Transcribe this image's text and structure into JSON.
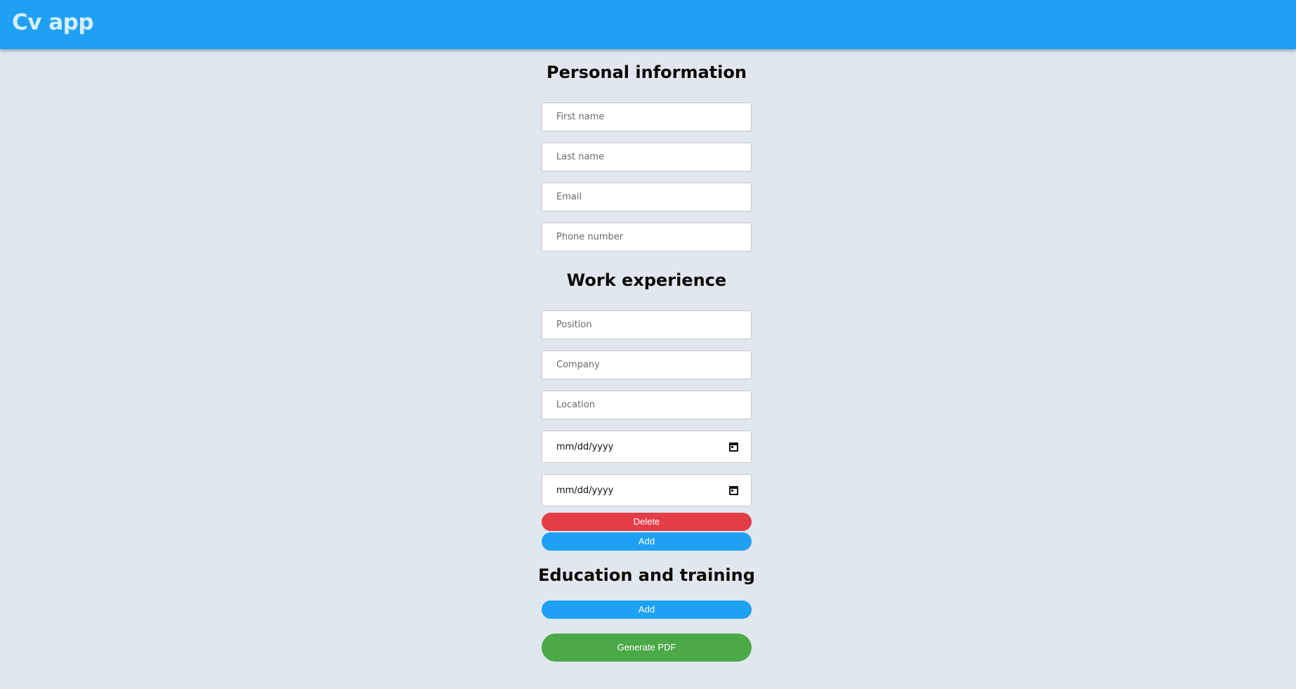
{
  "header": {
    "title": "Cv app"
  },
  "personal": {
    "title": "Personal information",
    "first_name_placeholder": "First name",
    "last_name_placeholder": "Last name",
    "email_placeholder": "Email",
    "phone_placeholder": "Phone number"
  },
  "work": {
    "title": "Work experience",
    "position_placeholder": "Position",
    "company_placeholder": "Company",
    "location_placeholder": "Location",
    "start_date": "mm/dd/yyyy",
    "end_date": "mm/dd/yyyy",
    "delete_label": "Delete",
    "add_label": "Add"
  },
  "education": {
    "title": "Education and training",
    "add_label": "Add"
  },
  "actions": {
    "generate_pdf_label": "Generate PDF"
  },
  "colors": {
    "header": "#1fa1f3",
    "background": "#e0e7ef",
    "delete": "#e33d47",
    "add": "#1fa1f3",
    "generate": "#4ca948"
  },
  "icons": {
    "date_picker": "calendar-icon"
  }
}
